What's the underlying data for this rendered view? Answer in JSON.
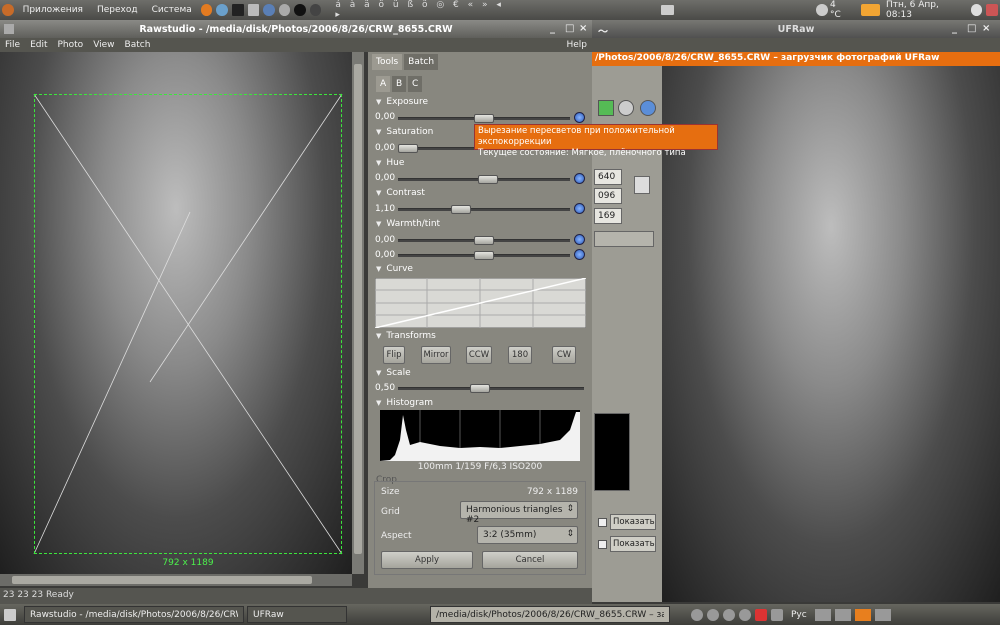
{
  "top_panel": {
    "applications": "Приложения",
    "places": "Переход",
    "system": "Система",
    "temperature": "4 °C",
    "clock": "Птн, 6 Апр, 08:13"
  },
  "rawstudio": {
    "title": "Rawstudio - /media/disk/Photos/2006/8/26/CRW_8655.CRW",
    "menu": {
      "file": "File",
      "edit": "Edit",
      "photo": "Photo",
      "view": "View",
      "batch": "Batch",
      "help": "Help"
    },
    "crop_label": "792 x 1189",
    "status": "23 23 23 Ready",
    "tabs": {
      "tools": "Tools",
      "batch": "Batch",
      "a": "A",
      "b": "B",
      "c": "C"
    },
    "exposure": {
      "label": "Exposure",
      "value": "0,00"
    },
    "saturation": {
      "label": "Saturation",
      "value": "0,00"
    },
    "hue": {
      "label": "Hue",
      "value": "0,00"
    },
    "contrast": {
      "label": "Contrast",
      "value": "1,10"
    },
    "warmth": {
      "label": "Warmth/tint",
      "value1": "0,00",
      "value2": "0,00"
    },
    "curve": {
      "label": "Curve"
    },
    "transforms": {
      "label": "Transforms",
      "flip": "Flip",
      "mirror": "Mirror",
      "ccw": "CCW",
      "r180": "180",
      "cw": "CW"
    },
    "scale": {
      "label": "Scale",
      "value": "0,50"
    },
    "histogram": {
      "label": "Histogram",
      "info": "100mm 1/159 F/6,3 ISO200"
    },
    "crop": {
      "label": "Crop",
      "size_label": "Size",
      "size_value": "792 x 1189",
      "grid_label": "Grid",
      "grid_value": "Harmonious triangles #2",
      "aspect_label": "Aspect",
      "aspect_value": "3:2 (35mm)",
      "apply": "Apply",
      "cancel": "Cancel"
    }
  },
  "tooltip": {
    "line1": "Вырезание пересветов при положительной экспокоррекции",
    "line2": "Текущее состояние: Мягкое, плёночного типа"
  },
  "ufraw": {
    "title": "UFRaw",
    "subtitle": "/Photos/2006/8/26/CRW_8655.CRW – загрузчик фотографий UFRaw",
    "val1": "640",
    "val2": "096",
    "val3": "169",
    "show1": "Показать",
    "show2": "Показать"
  },
  "taskbar": {
    "task1": "Rawstudio - /media/disk/Photos/2006/8/26/CRW_8655...",
    "task2": "UFRaw",
    "task3": "/media/disk/Photos/2006/8/26/CRW_8655.CRW – заг...",
    "lang": "Рус"
  }
}
